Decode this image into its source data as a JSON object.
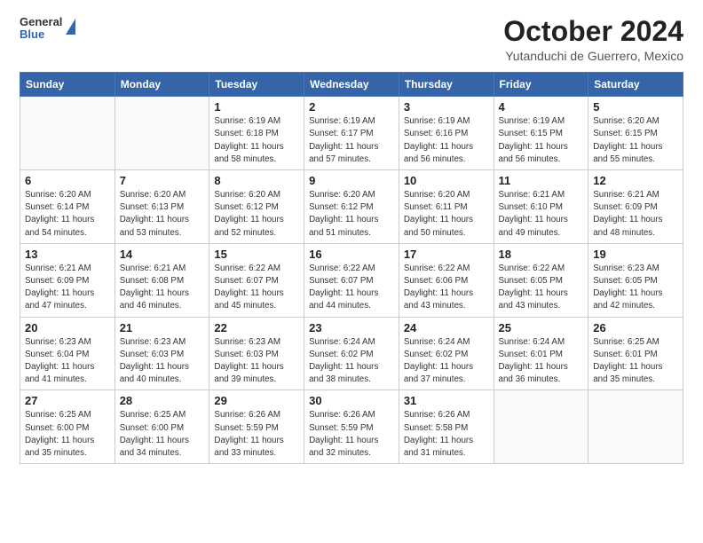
{
  "header": {
    "logo": {
      "line1": "General",
      "line2": "Blue"
    },
    "month": "October 2024",
    "location": "Yutanduchi de Guerrero, Mexico"
  },
  "weekdays": [
    "Sunday",
    "Monday",
    "Tuesday",
    "Wednesday",
    "Thursday",
    "Friday",
    "Saturday"
  ],
  "weeks": [
    [
      {
        "day": "",
        "info": ""
      },
      {
        "day": "",
        "info": ""
      },
      {
        "day": "1",
        "info": "Sunrise: 6:19 AM\nSunset: 6:18 PM\nDaylight: 11 hours and 58 minutes."
      },
      {
        "day": "2",
        "info": "Sunrise: 6:19 AM\nSunset: 6:17 PM\nDaylight: 11 hours and 57 minutes."
      },
      {
        "day": "3",
        "info": "Sunrise: 6:19 AM\nSunset: 6:16 PM\nDaylight: 11 hours and 56 minutes."
      },
      {
        "day": "4",
        "info": "Sunrise: 6:19 AM\nSunset: 6:15 PM\nDaylight: 11 hours and 56 minutes."
      },
      {
        "day": "5",
        "info": "Sunrise: 6:20 AM\nSunset: 6:15 PM\nDaylight: 11 hours and 55 minutes."
      }
    ],
    [
      {
        "day": "6",
        "info": "Sunrise: 6:20 AM\nSunset: 6:14 PM\nDaylight: 11 hours and 54 minutes."
      },
      {
        "day": "7",
        "info": "Sunrise: 6:20 AM\nSunset: 6:13 PM\nDaylight: 11 hours and 53 minutes."
      },
      {
        "day": "8",
        "info": "Sunrise: 6:20 AM\nSunset: 6:12 PM\nDaylight: 11 hours and 52 minutes."
      },
      {
        "day": "9",
        "info": "Sunrise: 6:20 AM\nSunset: 6:12 PM\nDaylight: 11 hours and 51 minutes."
      },
      {
        "day": "10",
        "info": "Sunrise: 6:20 AM\nSunset: 6:11 PM\nDaylight: 11 hours and 50 minutes."
      },
      {
        "day": "11",
        "info": "Sunrise: 6:21 AM\nSunset: 6:10 PM\nDaylight: 11 hours and 49 minutes."
      },
      {
        "day": "12",
        "info": "Sunrise: 6:21 AM\nSunset: 6:09 PM\nDaylight: 11 hours and 48 minutes."
      }
    ],
    [
      {
        "day": "13",
        "info": "Sunrise: 6:21 AM\nSunset: 6:09 PM\nDaylight: 11 hours and 47 minutes."
      },
      {
        "day": "14",
        "info": "Sunrise: 6:21 AM\nSunset: 6:08 PM\nDaylight: 11 hours and 46 minutes."
      },
      {
        "day": "15",
        "info": "Sunrise: 6:22 AM\nSunset: 6:07 PM\nDaylight: 11 hours and 45 minutes."
      },
      {
        "day": "16",
        "info": "Sunrise: 6:22 AM\nSunset: 6:07 PM\nDaylight: 11 hours and 44 minutes."
      },
      {
        "day": "17",
        "info": "Sunrise: 6:22 AM\nSunset: 6:06 PM\nDaylight: 11 hours and 43 minutes."
      },
      {
        "day": "18",
        "info": "Sunrise: 6:22 AM\nSunset: 6:05 PM\nDaylight: 11 hours and 43 minutes."
      },
      {
        "day": "19",
        "info": "Sunrise: 6:23 AM\nSunset: 6:05 PM\nDaylight: 11 hours and 42 minutes."
      }
    ],
    [
      {
        "day": "20",
        "info": "Sunrise: 6:23 AM\nSunset: 6:04 PM\nDaylight: 11 hours and 41 minutes."
      },
      {
        "day": "21",
        "info": "Sunrise: 6:23 AM\nSunset: 6:03 PM\nDaylight: 11 hours and 40 minutes."
      },
      {
        "day": "22",
        "info": "Sunrise: 6:23 AM\nSunset: 6:03 PM\nDaylight: 11 hours and 39 minutes."
      },
      {
        "day": "23",
        "info": "Sunrise: 6:24 AM\nSunset: 6:02 PM\nDaylight: 11 hours and 38 minutes."
      },
      {
        "day": "24",
        "info": "Sunrise: 6:24 AM\nSunset: 6:02 PM\nDaylight: 11 hours and 37 minutes."
      },
      {
        "day": "25",
        "info": "Sunrise: 6:24 AM\nSunset: 6:01 PM\nDaylight: 11 hours and 36 minutes."
      },
      {
        "day": "26",
        "info": "Sunrise: 6:25 AM\nSunset: 6:01 PM\nDaylight: 11 hours and 35 minutes."
      }
    ],
    [
      {
        "day": "27",
        "info": "Sunrise: 6:25 AM\nSunset: 6:00 PM\nDaylight: 11 hours and 35 minutes."
      },
      {
        "day": "28",
        "info": "Sunrise: 6:25 AM\nSunset: 6:00 PM\nDaylight: 11 hours and 34 minutes."
      },
      {
        "day": "29",
        "info": "Sunrise: 6:26 AM\nSunset: 5:59 PM\nDaylight: 11 hours and 33 minutes."
      },
      {
        "day": "30",
        "info": "Sunrise: 6:26 AM\nSunset: 5:59 PM\nDaylight: 11 hours and 32 minutes."
      },
      {
        "day": "31",
        "info": "Sunrise: 6:26 AM\nSunset: 5:58 PM\nDaylight: 11 hours and 31 minutes."
      },
      {
        "day": "",
        "info": ""
      },
      {
        "day": "",
        "info": ""
      }
    ]
  ]
}
